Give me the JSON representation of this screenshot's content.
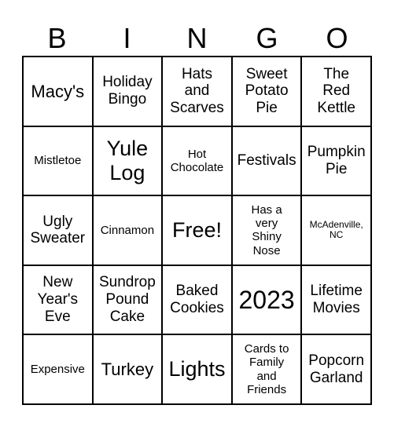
{
  "header": {
    "letters": [
      "B",
      "I",
      "N",
      "G",
      "O"
    ]
  },
  "cells": [
    [
      "Macy's",
      "Holiday\nBingo",
      "Hats\nand\nScarves",
      "Sweet\nPotato\nPie",
      "The\nRed\nKettle"
    ],
    [
      "Mistletoe",
      "Yule\nLog",
      "Hot\nChocolate",
      "Festivals",
      "Pumpkin\nPie"
    ],
    [
      "Ugly\nSweater",
      "Cinnamon",
      "Free!",
      "Has a\nvery\nShiny\nNose",
      "McAdenville,\nNC"
    ],
    [
      "New\nYear's\nEve",
      "Sundrop\nPound\nCake",
      "Baked\nCookies",
      "2023",
      "Lifetime\nMovies"
    ],
    [
      "Expensive",
      "Turkey",
      "Lights",
      "Cards to\nFamily\nand\nFriends",
      "Popcorn\nGarland"
    ]
  ]
}
